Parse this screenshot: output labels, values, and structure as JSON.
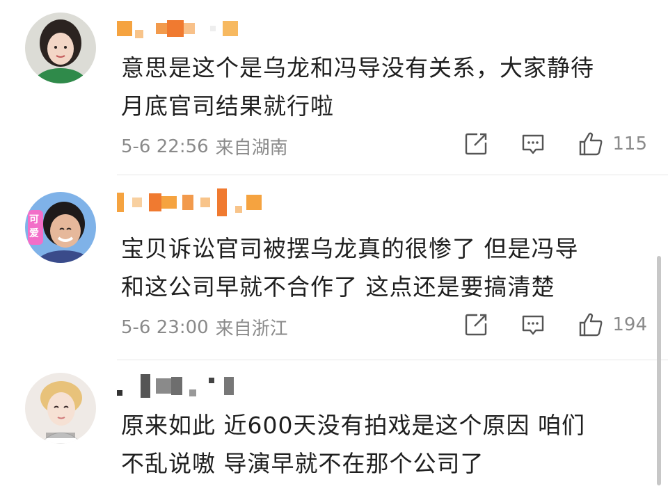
{
  "comments": [
    {
      "text": "意思是这个是乌龙和冯导没有关系，大家静待\n月底官司结果就行啦",
      "date": "5-6 22:56",
      "location": "来自湖南",
      "likes": "115"
    },
    {
      "text": "宝贝诉讼官司被摆乌龙真的很惨了 但是冯导\n和这公司早就不合作了 这点还是要搞清楚",
      "date": "5-6 23:00",
      "location": "来自浙江",
      "likes": "194",
      "avatar_badge": "可爱"
    },
    {
      "text": "原来如此 近600天没有拍戏是这个原因 咱们\n不乱说嗷 导演早就不在那个公司了"
    }
  ],
  "icons": {
    "share": "share-icon",
    "comment": "comment-icon",
    "like": "like-icon"
  },
  "colors": {
    "meta_text": "#8a8a8a",
    "body_text": "#1f1f1f",
    "divider": "#e6e6e6",
    "blur_orange": "#f5a340",
    "blur_gray": "#9a9a9a"
  }
}
